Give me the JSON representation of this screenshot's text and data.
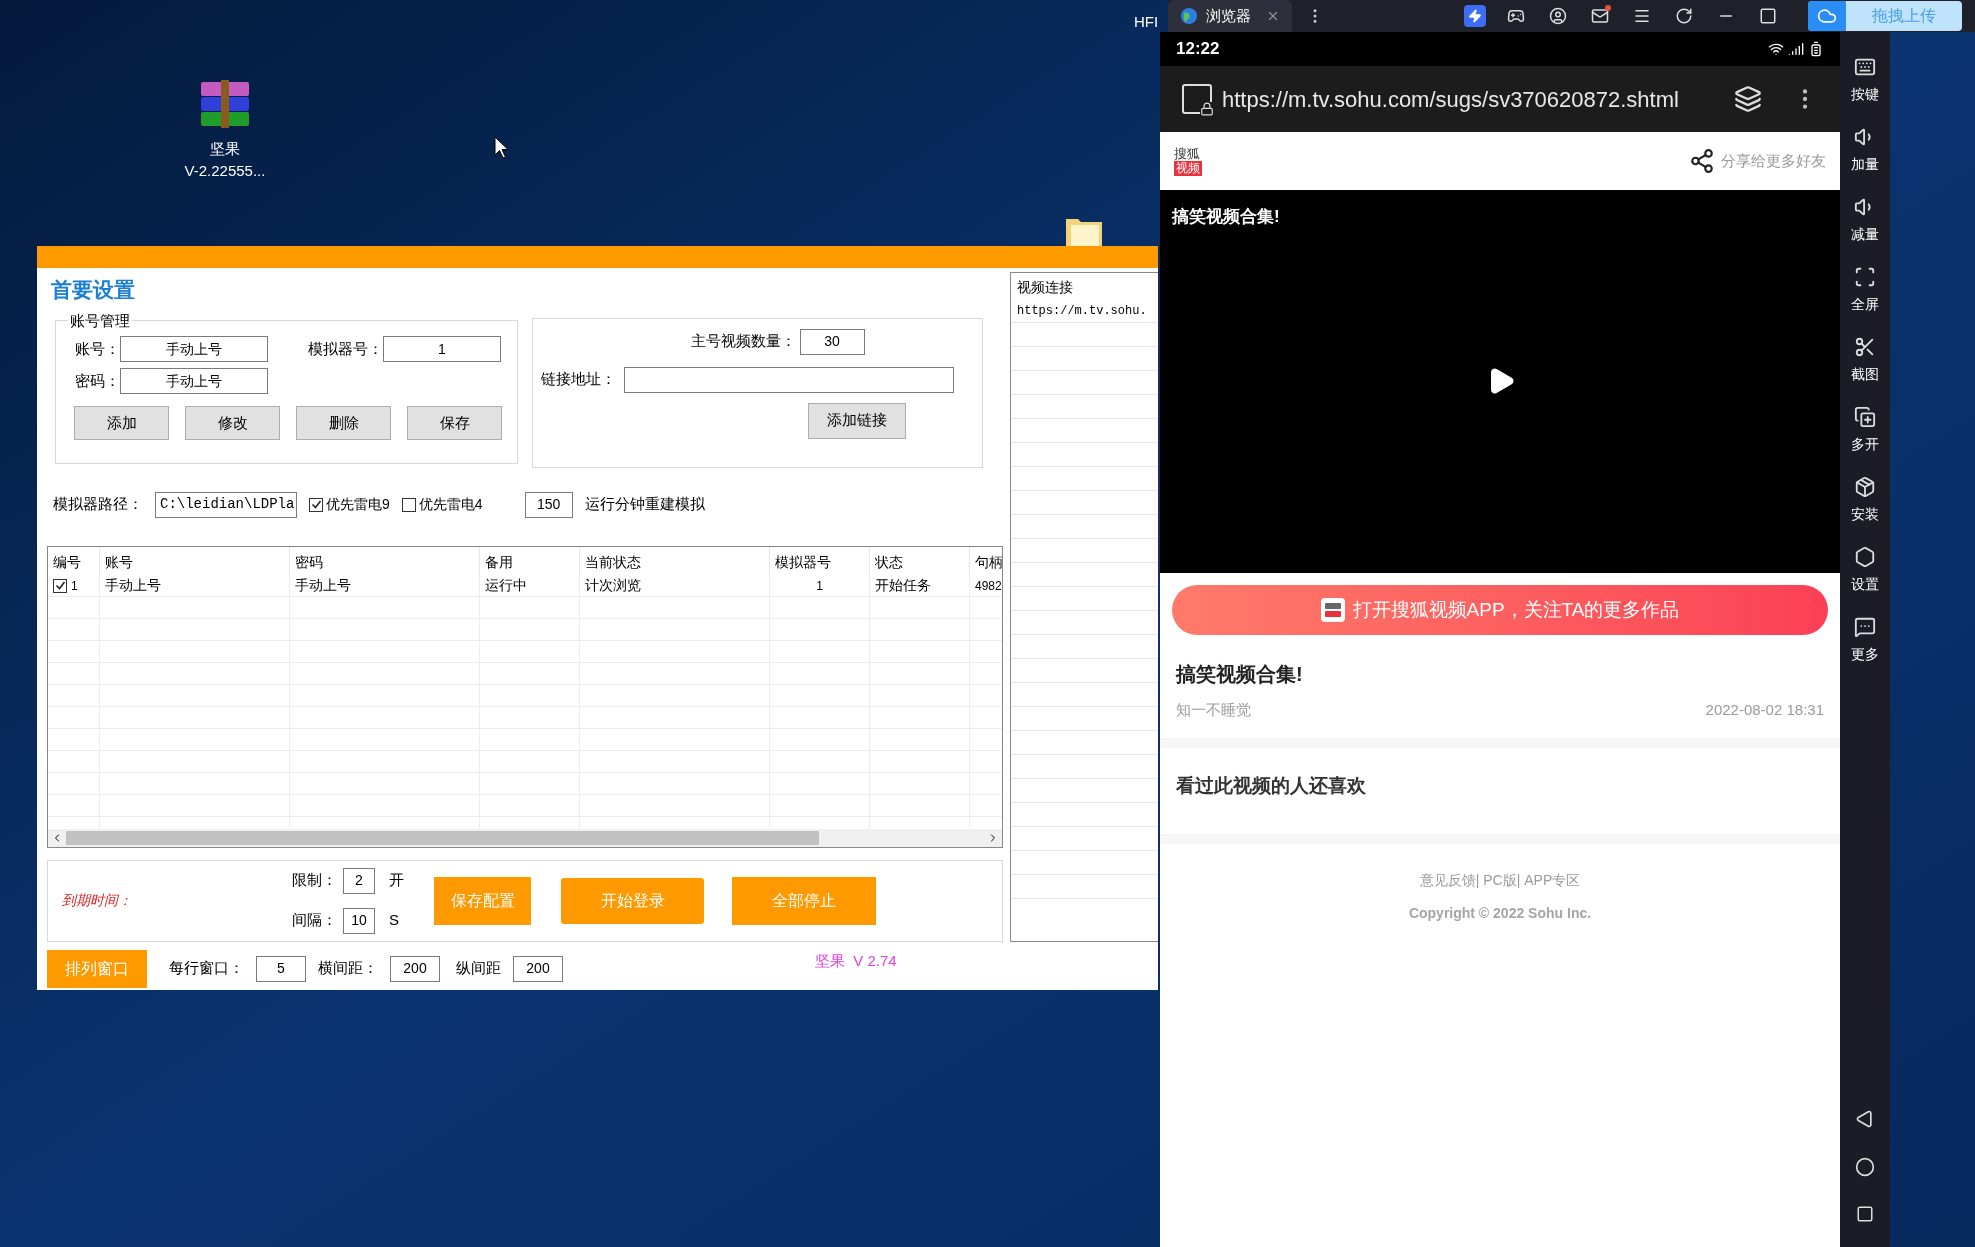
{
  "desktop": {
    "icon_label": [
      "坚果",
      "V-2.22555..."
    ],
    "edge_text": "HFI"
  },
  "app_window": {
    "title": "首要设置",
    "account_group": {
      "title": "账号管理",
      "account_label": "账号：",
      "account_value": "手动上号",
      "emulator_label": "模拟器号：",
      "emulator_value": "1",
      "password_label": "密码：",
      "password_value": "手动上号",
      "buttons": [
        "添加",
        "修改",
        "删除",
        "保存"
      ]
    },
    "video_group": {
      "count_label": "主号视频数量：",
      "count_value": "30",
      "link_label": "链接地址：",
      "button": "添加链接"
    },
    "path_row": {
      "label": "模拟器路径：",
      "value": "C:\\leidian\\LDPla",
      "options": [
        {
          "label": "优先雷电9",
          "checked": true
        },
        {
          "label": "优先雷电4",
          "checked": false
        }
      ],
      "minutes_value": "150",
      "minutes_label": "运行分钟重建模拟"
    },
    "table": {
      "columns": [
        "编号",
        "账号",
        "密码",
        "备用",
        "当前状态",
        "模拟器号",
        "状态",
        "句柄"
      ],
      "rows": [
        {
          "checked": true,
          "cells": [
            "1",
            "手动上号",
            "手动上号",
            "运行中",
            "计次浏览",
            "1",
            "开始任务",
            "4982"
          ]
        }
      ]
    },
    "control_panel": {
      "expiry_label": "到期时间：",
      "limit_label": "限制：",
      "limit_value": "2",
      "limit_unit": "开",
      "interval_label": "间隔：",
      "interval_value": "10",
      "interval_unit": "S",
      "buttons": [
        "保存配置",
        "开始登录",
        "全部停止"
      ]
    },
    "arrange_row": {
      "button": "排列窗口",
      "per_row_label": "每行窗口：",
      "per_row_value": "5",
      "h_gap_label": "横间距：",
      "h_gap_value": "200",
      "v_gap_label": "纵间距",
      "v_gap_value": "200",
      "version": "坚果  V 2.74"
    },
    "link_list": {
      "title": "视频连接",
      "items": [
        "https://m.tv.sohu."
      ]
    }
  },
  "emulator": {
    "tab": "浏览器",
    "upload_button": "拖拽上传",
    "toolbar": [
      "按键",
      "加量",
      "减量",
      "全屏",
      "截图",
      "多开",
      "安装",
      "设置",
      "更多"
    ],
    "phone": {
      "time": "12:22",
      "url": "https://m.tv.sohu.com/sugs/sv370620872.shtml",
      "logo_top": "搜狐",
      "logo_badge": "视频",
      "share": "分享给更多好友",
      "video_title": "搞笑视频合集!",
      "app_button": "打开搜狐视频APP，关注TA的更多作品",
      "title": "搞笑视频合集!",
      "author": "知一不睡觉",
      "date": "2022-08-02 18:31",
      "related": "看过此视频的人还喜欢",
      "footer_links": "意见反馈| PC版| APP专区",
      "copyright": "Copyright © 2022 Sohu Inc."
    }
  }
}
